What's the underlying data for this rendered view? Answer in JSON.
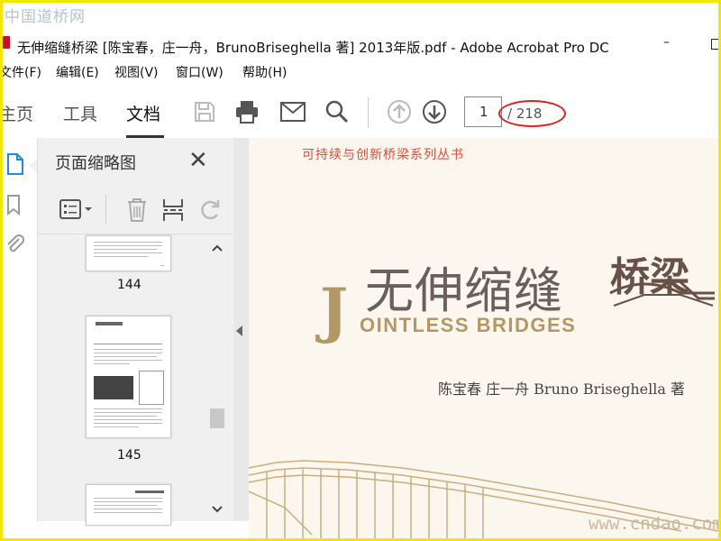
{
  "watermark_top": "中国道桥网",
  "watermark_bottom": "www.cndao.com",
  "window": {
    "title": "无伸缩缝桥梁 [陈宝春，庄一舟，BrunoBriseghella 著] 2013年版.pdf - Adobe Acrobat Pro DC",
    "minimize": "–"
  },
  "menu": [
    "文件(F)",
    "编辑(E)",
    "视图(V)",
    "窗口(W)",
    "帮助(H)"
  ],
  "tabs": {
    "home": "主页",
    "tools": "工具",
    "document": "文档"
  },
  "toolbar": {
    "current_page": "1",
    "total_pages": "/ 218"
  },
  "panel": {
    "title": "页面缩略图",
    "close": "✕",
    "thumbnails": [
      {
        "label": "144"
      },
      {
        "label": "145"
      }
    ]
  },
  "cover": {
    "series": "可持续与创新桥梁系列丛书",
    "title_cn_main": "无伸缩缝",
    "title_cn_bold": "桥梁",
    "title_en_initial": "J",
    "title_en_rest": "OINTLESS BRIDGES",
    "authors": "陈宝春    庄一舟    Bruno Briseghella    著"
  },
  "colors": {
    "accent_red": "#e0201a",
    "brand_gold": "#b39863",
    "icon_blue": "#1e88e5"
  }
}
